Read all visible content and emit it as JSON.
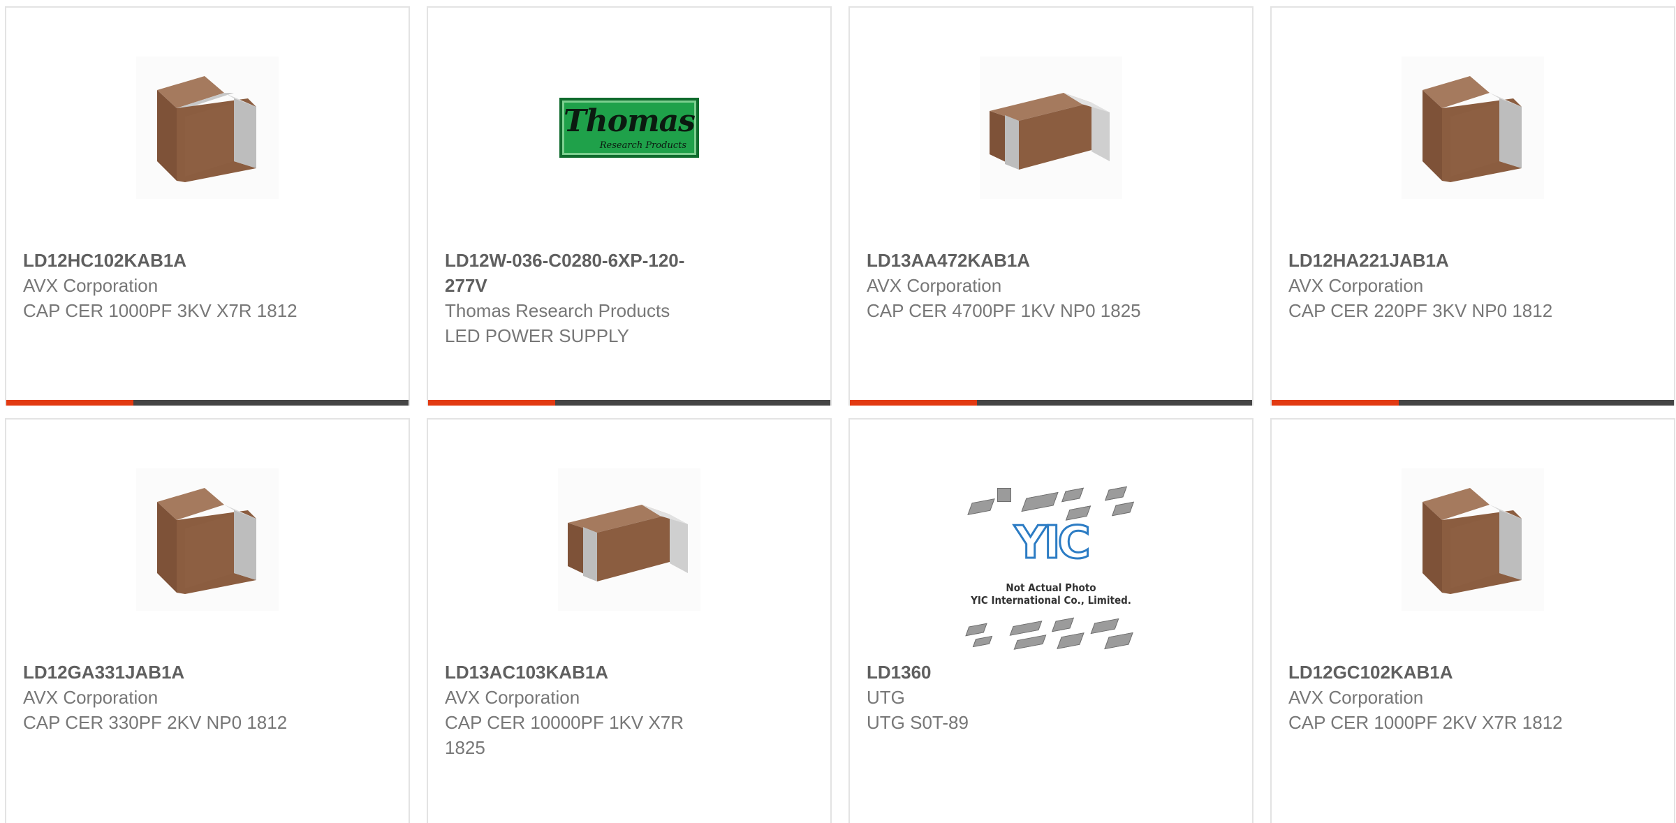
{
  "products": [
    {
      "part_number": "LD12HC102KAB1A",
      "manufacturer": "AVX Corporation",
      "description": "CAP CER 1000PF 3KV X7R 1812",
      "image": "ceramic-capacitor-cube"
    },
    {
      "part_number": "LD12W-036-C0280-6XP-120-277V",
      "manufacturer": "Thomas Research Products",
      "description": "LED POWER SUPPLY",
      "image": "thomas-research-products-logo",
      "logo_text": "Thomas",
      "logo_subtext": "Research Products"
    },
    {
      "part_number": "LD13AA472KAB1A",
      "manufacturer": "AVX Corporation",
      "description": "CAP CER 4700PF 1KV NP0 1825",
      "image": "ceramic-capacitor-wide"
    },
    {
      "part_number": "LD12HA221JAB1A",
      "manufacturer": "AVX Corporation",
      "description": "CAP CER 220PF 3KV NP0 1812",
      "image": "ceramic-capacitor-cube"
    },
    {
      "part_number": "LD12GA331JAB1A",
      "manufacturer": "AVX Corporation",
      "description": "CAP CER 330PF 2KV NP0 1812",
      "image": "ceramic-capacitor-cube"
    },
    {
      "part_number": "LD13AC103KAB1A",
      "manufacturer": "AVX Corporation",
      "description": "CAP CER 10000PF 1KV X7R 1825",
      "image": "ceramic-capacitor-wide"
    },
    {
      "part_number": "LD1360",
      "manufacturer": "UTG",
      "description": "UTG S0T-89",
      "image": "yic-placeholder",
      "logo_text": "YIC",
      "note_line1": "Not Actual Photo",
      "note_line2": "YIC International Co., Limited."
    },
    {
      "part_number": "LD12GC102KAB1A",
      "manufacturer": "AVX Corporation",
      "description": "CAP CER 1000PF 2KV X7R 1812",
      "image": "ceramic-capacitor-cube"
    }
  ],
  "colors": {
    "accent": "#e23a12",
    "bar": "#454545",
    "capacitor_body": "#8a5a3c",
    "capacitor_cap": "#d0d0d0"
  }
}
